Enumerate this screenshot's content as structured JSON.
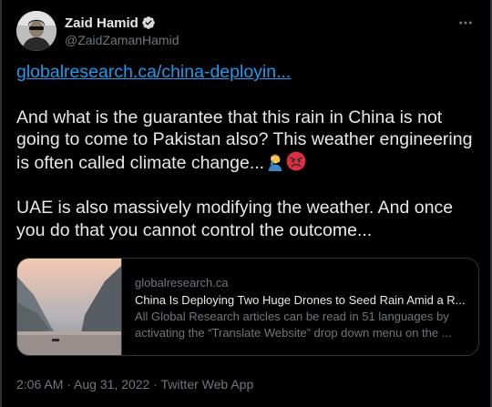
{
  "author": {
    "display_name": "Zaid Hamid",
    "handle": "@ZaidZamanHamid"
  },
  "tweet": {
    "link_text": "globalresearch.ca/china-deployin...",
    "paragraph1": "And what is the guarantee that this rain in China is not going to come to Pakistan also? This weather engineering is often called climate change...",
    "paragraph2": "UAE is also massively modifying the weather. And once you do that you cannot control the outcome...",
    "emojis": [
      "man-facepalming-icon",
      "angry-face-icon"
    ]
  },
  "card": {
    "domain": "globalresearch.ca",
    "title": "China Is Deploying Two Huge Drones to Seed Rain Amid a R...",
    "description_line1": "All Global Research articles can be read in 51 languages by",
    "description_line2": "activating the “Translate Website” drop down menu on the ..."
  },
  "meta": {
    "time": "2:06 AM",
    "separator": " · ",
    "date": "Aug 31, 2022",
    "source": "Twitter Web App"
  },
  "colors": {
    "background": "#000000",
    "text": "#e7e9ea",
    "secondary": "#71767b",
    "link": "#1d9bf0",
    "border": "#2f3336",
    "verified": "#d9d9d9"
  }
}
